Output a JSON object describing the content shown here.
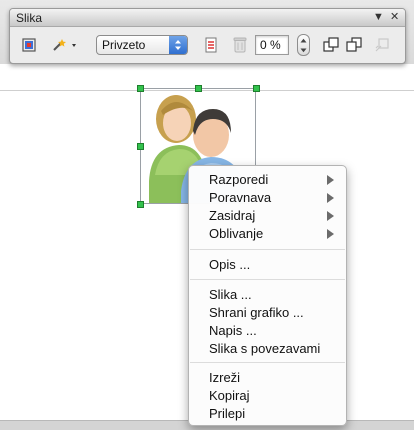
{
  "toolbar": {
    "title": "Slika",
    "menu_glyph": "▼",
    "close_glyph": "✕",
    "mode_select": {
      "value": "Privzeto"
    },
    "transparency": {
      "value": "0 %"
    },
    "icons": [
      "filter-icon",
      "color-icon",
      "graphics-mode-select",
      "crop-icon",
      "trash-icon",
      "transparency-stepper",
      "bring-forward-icon",
      "send-backward-icon",
      "wrap-icon"
    ]
  },
  "image": {
    "icon": "users-icon"
  },
  "context_menu": {
    "groups": [
      {
        "items": [
          {
            "label": "Razporedi",
            "submenu": true
          },
          {
            "label": "Poravnava",
            "submenu": true
          },
          {
            "label": "Zasidraj",
            "submenu": true
          },
          {
            "label": "Oblivanje",
            "submenu": true
          }
        ]
      },
      {
        "items": [
          {
            "label": "Opis ...",
            "submenu": false
          }
        ]
      },
      {
        "items": [
          {
            "label": "Slika ...",
            "submenu": false
          },
          {
            "label": "Shrani grafiko ...",
            "submenu": false
          },
          {
            "label": "Napis ...",
            "submenu": false
          },
          {
            "label": "Slika s povezavami",
            "submenu": false
          }
        ]
      },
      {
        "items": [
          {
            "label": "Izreži",
            "submenu": false
          },
          {
            "label": "Kopiraj",
            "submenu": false
          },
          {
            "label": "Prilepi",
            "submenu": false
          }
        ]
      }
    ]
  },
  "colors": {
    "handle": "#33c24d",
    "select_accent": "#2f6fd0"
  }
}
